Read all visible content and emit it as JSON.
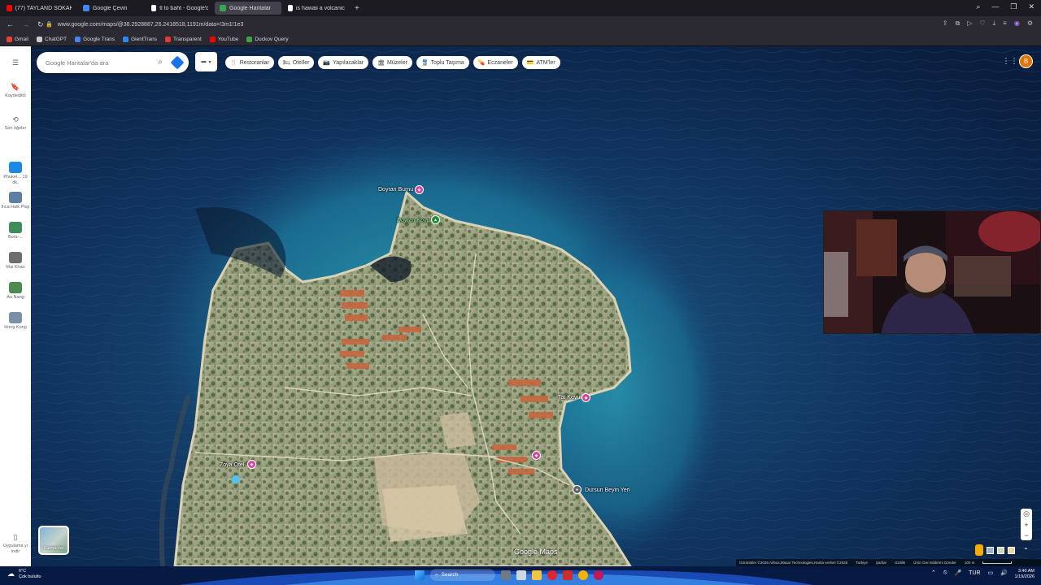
{
  "browser": {
    "tabs": [
      {
        "title": "(77) TAYLAND SOKAK LE:",
        "color": "#ff0000",
        "active": false
      },
      {
        "title": "Google Çeviri",
        "color": "#4285f4",
        "active": false
      },
      {
        "title": "tl to baht - Google'da Ara",
        "color": "#ffffff",
        "active": false
      },
      {
        "title": "Google Haritalar",
        "color": "#34a853",
        "active": true
      },
      {
        "title": "is hawaii a volcanic island",
        "color": "#ffffff",
        "active": false
      }
    ],
    "url": "www.google.com/maps/@38.2928887,26.2418518,1191m/data=!3m1!1e3",
    "bookmarks": [
      {
        "label": "Gmail",
        "color": "#ea4335"
      },
      {
        "label": "ChatGPT",
        "color": "#cccccc"
      },
      {
        "label": "Google Trans",
        "color": "#4285f4"
      },
      {
        "label": "GientTrans",
        "color": "#2f86f6"
      },
      {
        "label": "Transparent",
        "color": "#e53935"
      },
      {
        "label": "YouTube",
        "color": "#ff0000"
      },
      {
        "label": "Duckov Query",
        "color": "#43a047"
      }
    ]
  },
  "search": {
    "placeholder": "Google Haritalar'da ara"
  },
  "chips": [
    {
      "label": "Restoranlar",
      "icon": "fork-knife-icon",
      "glyph": "🍴"
    },
    {
      "label": "Oteller",
      "icon": "bed-icon",
      "glyph": "🛏"
    },
    {
      "label": "Yapılacaklar",
      "icon": "camera-icon",
      "glyph": "📷"
    },
    {
      "label": "Müzeler",
      "icon": "museum-icon",
      "glyph": "🏛"
    },
    {
      "label": "Toplu Taşıma",
      "icon": "transit-icon",
      "glyph": "🚆"
    },
    {
      "label": "Eczaneler",
      "icon": "pharmacy-icon",
      "glyph": "💊"
    },
    {
      "label": "ATM'ler",
      "icon": "atm-icon",
      "glyph": "💳"
    }
  ],
  "sidebar": {
    "saved": "Kaydedildi",
    "recent": "Son öğeler",
    "items": [
      {
        "label": "Phuket... 19 dk.",
        "color": "#1e88e5"
      },
      {
        "label": "Ilıca Halk Plajı",
        "color": "#5c7fa3"
      },
      {
        "label": "Bora-...",
        "color": "#3c8d5a"
      },
      {
        "label": "Mai Khao",
        "color": "#6d6d6d"
      },
      {
        "label": "Ao Nang",
        "color": "#4a8b4f"
      },
      {
        "label": "Hong Kong",
        "color": "#7b8fa6"
      }
    ],
    "apps": "Uygulama yı indir"
  },
  "user": {
    "initial": "B",
    "color": "#e37400"
  },
  "places": {
    "doyran_burnu": "Doyran Burnu",
    "doyran_koyu": "Doyran Koyu",
    "tat_koyu": "Tat Koyu",
    "zoya_otel": "Zoya Otel",
    "dursun_beyin_yeri": "Dursun Beyin Yeri"
  },
  "map": {
    "layers_label": "Katmanlar",
    "logo": "Google Maps",
    "footer": [
      "Görüntüler ©2026 Airbus,Maxar Technologies,Harita verileri ©2026",
      "Türkiye",
      "Şartlar",
      "Gizlilik",
      "Ürün Geri Bildirimi Gönder",
      "100 m"
    ]
  },
  "taskbar": {
    "temp": "6°C",
    "weather": "Çok bulutlu",
    "search": "Search",
    "lang": "TUR",
    "time": "3:40 AM",
    "date": "1/19/2026"
  }
}
